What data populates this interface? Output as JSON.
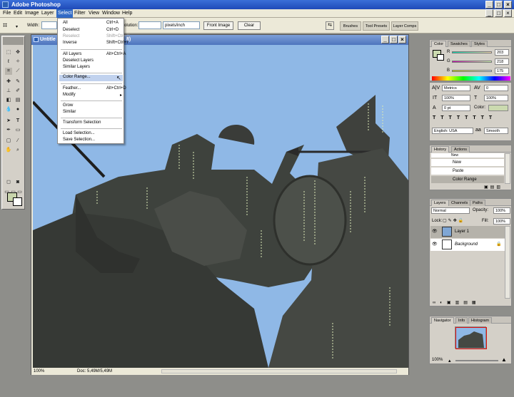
{
  "app": {
    "title": "Adobe Photoshop"
  },
  "menubar": {
    "items": [
      "File",
      "Edit",
      "Image",
      "Layer",
      "Select",
      "Filter",
      "View",
      "Window",
      "Help"
    ]
  },
  "options": {
    "width_label": "Width:",
    "resolution_label": "olution:",
    "units_value": "pixels/inch",
    "front_image": "Front Image",
    "clear": "Clear",
    "palette_tabs": [
      "Brushes",
      "Tool Presets",
      "Layer Comps"
    ]
  },
  "document": {
    "title": "Untitle",
    "title_suffix": "8)",
    "zoom": "100%",
    "doc_info": "Doc: 5,49M/5,49M"
  },
  "select_menu": {
    "items": [
      {
        "label": "All",
        "shortcut": "Ctrl+A",
        "disabled": false
      },
      {
        "label": "Deselect",
        "shortcut": "Ctrl+D",
        "disabled": false
      },
      {
        "label": "Reselect",
        "shortcut": "Shift+Ctrl+D",
        "disabled": true
      },
      {
        "label": "Inverse",
        "shortcut": "Shift+Ctrl+I",
        "disabled": false
      },
      {
        "label": "All Layers",
        "shortcut": "Alt+Ctrl+A",
        "disabled": false
      },
      {
        "label": "Deselect Layers",
        "shortcut": "",
        "disabled": false
      },
      {
        "label": "Similar Layers",
        "shortcut": "",
        "disabled": false
      },
      {
        "label": "Color Range...",
        "shortcut": "",
        "disabled": false
      },
      {
        "label": "Feather...",
        "shortcut": "Alt+Ctrl+D",
        "disabled": false
      },
      {
        "label": "Modify",
        "shortcut": "",
        "disabled": false
      },
      {
        "label": "Grow",
        "shortcut": "",
        "disabled": false
      },
      {
        "label": "Similar",
        "shortcut": "",
        "disabled": false
      },
      {
        "label": "Transform Selection",
        "shortcut": "",
        "disabled": false
      },
      {
        "label": "Load Selection...",
        "shortcut": "",
        "disabled": false
      },
      {
        "label": "Save Selection...",
        "shortcut": "",
        "disabled": false
      }
    ]
  },
  "color_panel": {
    "tabs": [
      "Color",
      "Swatches",
      "Styles"
    ],
    "channels": [
      {
        "name": "R",
        "value": "203"
      },
      {
        "name": "G",
        "value": "218"
      },
      {
        "name": "B",
        "value": "175"
      }
    ],
    "foreground_hex": "#cbdaaf"
  },
  "character_panel": {
    "font_style": "Metrics",
    "tracking": "0",
    "size1": "100%",
    "size2": "100%",
    "baseline": "0 pt",
    "color_label": "Color:",
    "language": "English: USA",
    "antialias": "Smooth"
  },
  "history_panel": {
    "tabs": [
      "History",
      "Actions"
    ],
    "items": [
      "New",
      "New",
      "Paste",
      "Color Range"
    ]
  },
  "layers_panel": {
    "tabs": [
      "Layers",
      "Channels",
      "Paths"
    ],
    "blend_mode": "Normal",
    "opacity_label": "Opacity:",
    "opacity": "100%",
    "lock_label": "Lock:",
    "fill_label": "Fill:",
    "fill": "100%",
    "layers": [
      "Layer 1",
      "Background"
    ]
  },
  "navigator_panel": {
    "tabs": [
      "Navigator",
      "Info",
      "Histogram"
    ],
    "zoom": "100%"
  },
  "colors": {
    "selection_blue": "#316ac5",
    "title_blue": "#1f4ab8",
    "sky": "#8fb8e6"
  }
}
